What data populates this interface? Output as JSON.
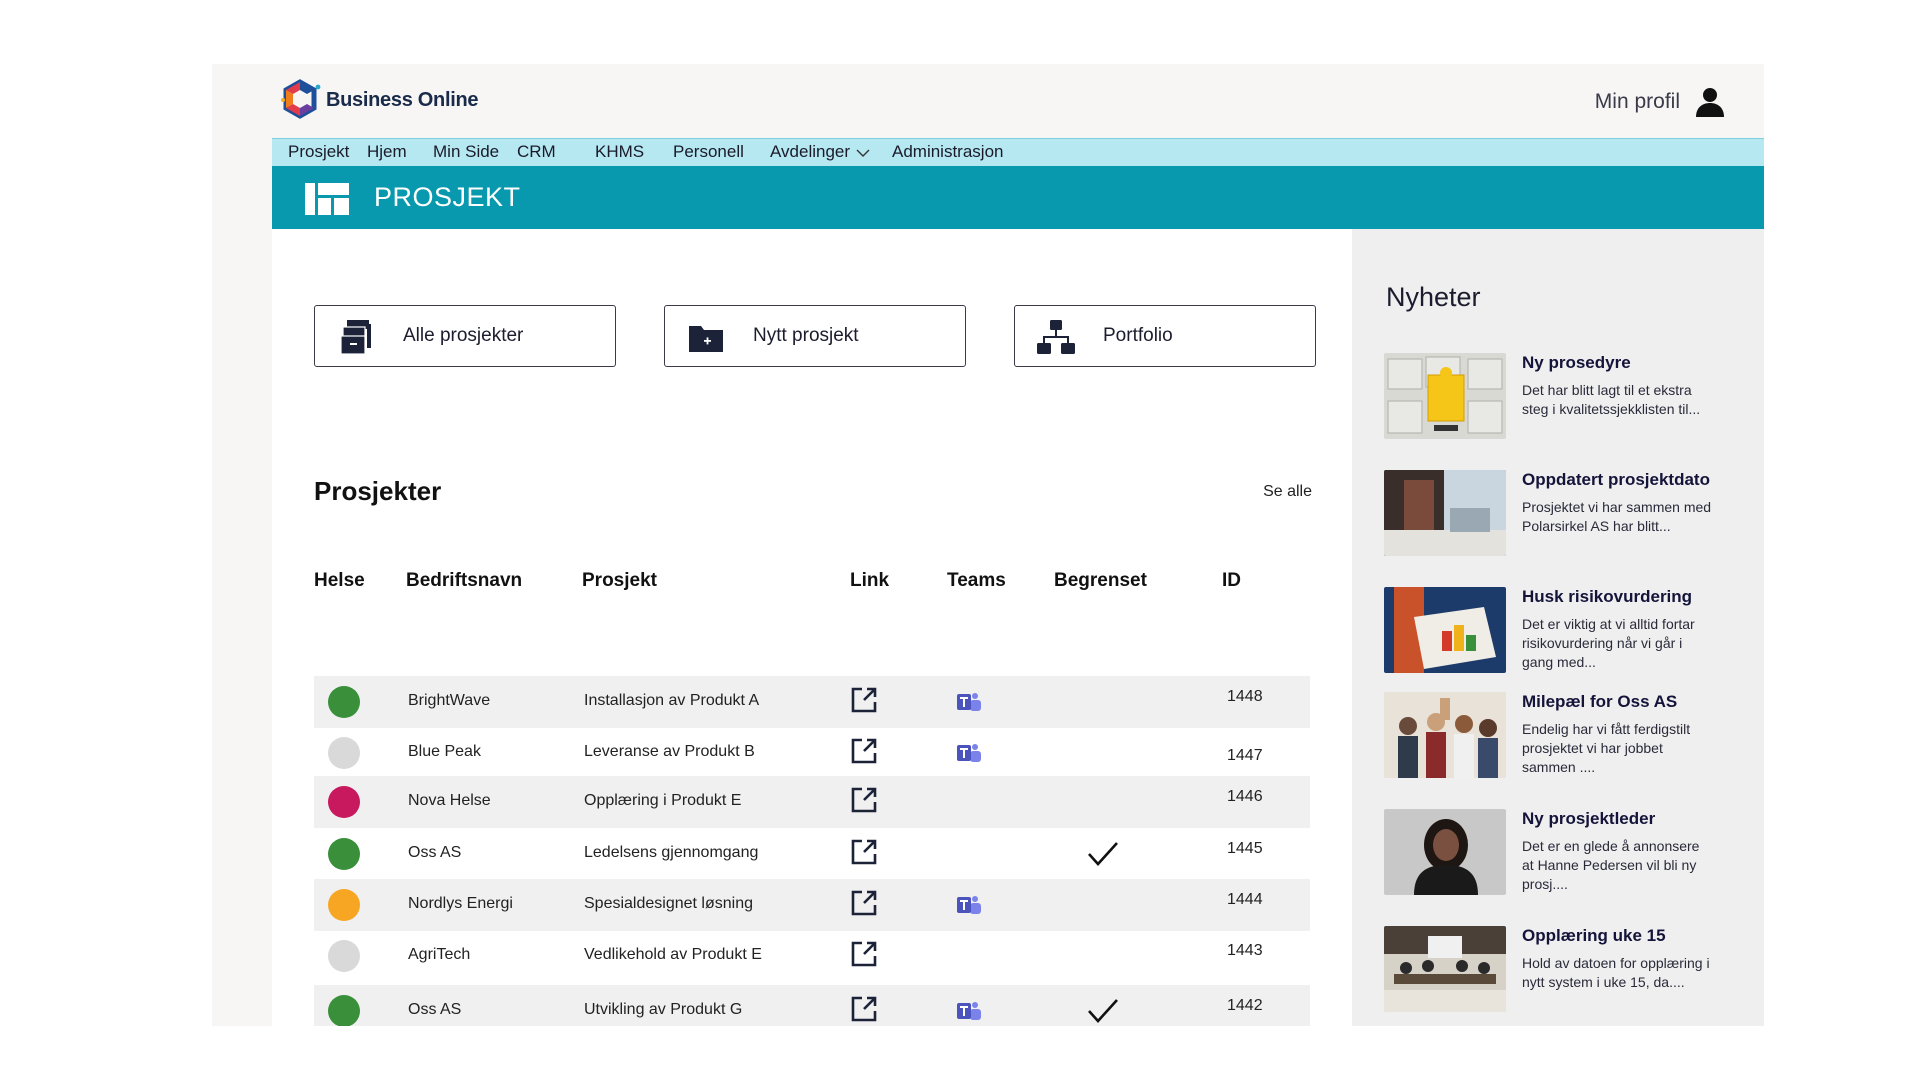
{
  "app": {
    "name": "Business Online"
  },
  "header": {
    "profile_label": "Min profil"
  },
  "menu": [
    {
      "label": "Prosjekt"
    },
    {
      "label": "Hjem"
    },
    {
      "label": "Min Side"
    },
    {
      "label": "CRM"
    },
    {
      "label": "KHMS"
    },
    {
      "label": "Personell"
    },
    {
      "label": "Avdelinger",
      "has_dropdown": true
    },
    {
      "label": "Administrasjon"
    }
  ],
  "banner": {
    "title": "PROSJEKT"
  },
  "actions": [
    {
      "label": "Alle prosjekter",
      "icon": "archive-boxes-icon"
    },
    {
      "label": "Nytt prosjekt",
      "icon": "new-folder-icon"
    },
    {
      "label": "Portfolio",
      "icon": "hierarchy-icon"
    }
  ],
  "projects": {
    "title": "Prosjekter",
    "see_all": "Se alle",
    "columns": [
      "Helse",
      "Bedriftsnavn",
      "Prosjekt",
      "Link",
      "Teams",
      "Begrenset",
      "ID"
    ],
    "rows": [
      {
        "health": "#3a8f3a",
        "company": "BrightWave",
        "project": "Installasjon av Produkt A",
        "teams": true,
        "restricted": false,
        "id": "1448"
      },
      {
        "health": "#d9d9d9",
        "company": "Blue Peak",
        "project": "Leveranse av Produkt B",
        "teams": true,
        "restricted": false,
        "id": "1447"
      },
      {
        "health": "#c8185e",
        "company": "Nova Helse",
        "project": "Opplæring i Produkt E",
        "teams": false,
        "restricted": false,
        "id": "1446"
      },
      {
        "health": "#3a8f3a",
        "company": "Oss AS",
        "project": "Ledelsens gjennomgang",
        "teams": false,
        "restricted": true,
        "id": "1445"
      },
      {
        "health": "#f6a623",
        "company": "Nordlys Energi",
        "project": "Spesialdesignet løsning",
        "teams": true,
        "restricted": false,
        "id": "1444"
      },
      {
        "health": "#d9d9d9",
        "company": "AgriTech",
        "project": "Vedlikehold av Produkt E",
        "teams": false,
        "restricted": false,
        "id": "1443"
      },
      {
        "health": "#3a8f3a",
        "company": "Oss AS",
        "project": "Utvikling av Produkt G",
        "teams": true,
        "restricted": true,
        "id": "1442"
      }
    ]
  },
  "news": {
    "title": "Nyheter",
    "items": [
      {
        "title": "Ny prosedyre",
        "body": "Det har blitt lagt til et ekstra steg i kvalitetssjekklisten til...",
        "thumb": "puzzle"
      },
      {
        "title": "Oppdatert prosjektdato",
        "body": "Prosjektet vi har sammen med Polarsirkel AS har blitt...",
        "thumb": "meeting"
      },
      {
        "title": "Husk risikovurdering",
        "body": "Det er viktig at vi alltid fortar risikovurdering når vi går i gang med...",
        "thumb": "chart"
      },
      {
        "title": "Milepæl for Oss AS",
        "body": "Endelig har vi fått ferdigstilt prosjektet vi har jobbet sammen ....",
        "thumb": "team"
      },
      {
        "title": "Ny prosjektleder",
        "body": "Det er en glede å annonsere at Hanne Pedersen vil bli ny prosj....",
        "thumb": "portrait"
      },
      {
        "title": "Opplæring uke 15",
        "body": "Hold av datoen for opplæring i nytt system i uke 15, da....",
        "thumb": "training"
      }
    ]
  }
}
